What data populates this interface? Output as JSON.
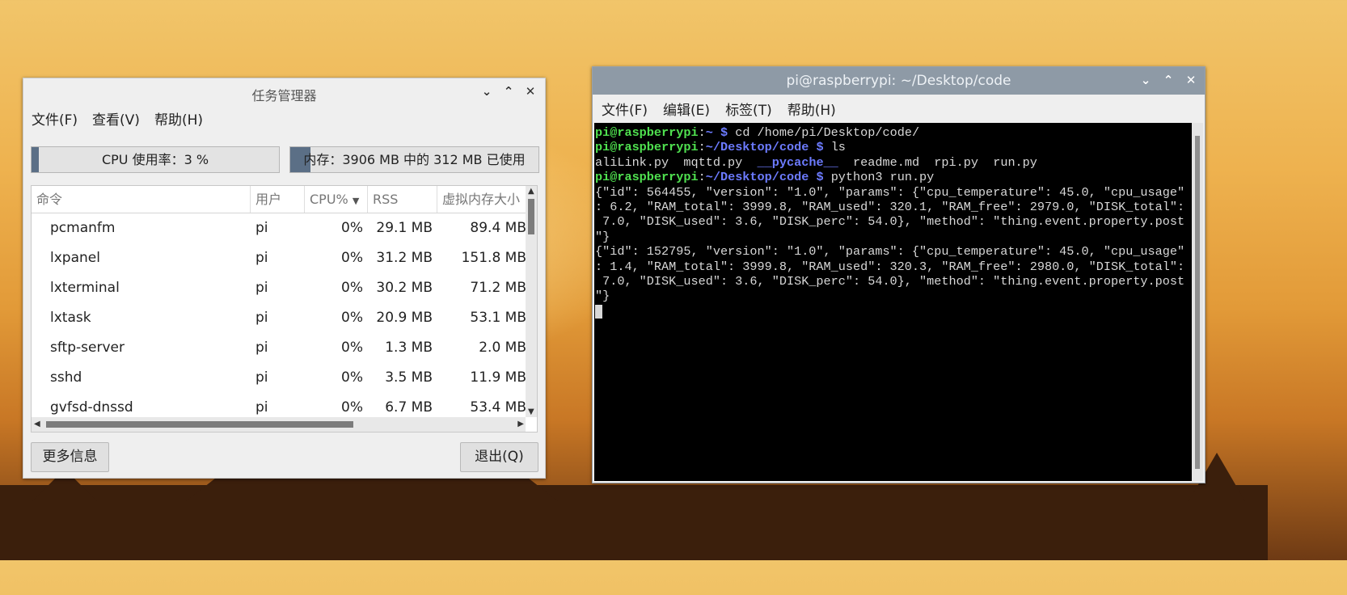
{
  "task_manager": {
    "title": "任务管理器",
    "menu": [
      "文件(F)",
      "查看(V)",
      "帮助(H)"
    ],
    "cpu_meter": {
      "label": "CPU 使用率：3 %",
      "fraction": 0.03
    },
    "mem_meter": {
      "label": "内存：3906 MB 中的 312 MB 已使用",
      "fraction": 0.08
    },
    "columns": [
      "命令",
      "用户",
      "CPU%",
      "RSS",
      "虚拟内存大小"
    ],
    "sort_column": "CPU%",
    "rows": [
      {
        "cmd": "pcmanfm",
        "user": "pi",
        "cpu": "0%",
        "rss": "29.1 MB",
        "vsz": "89.4 MB"
      },
      {
        "cmd": "lxpanel",
        "user": "pi",
        "cpu": "0%",
        "rss": "31.2 MB",
        "vsz": "151.8 MB"
      },
      {
        "cmd": "lxterminal",
        "user": "pi",
        "cpu": "0%",
        "rss": "30.2 MB",
        "vsz": "71.2 MB"
      },
      {
        "cmd": "lxtask",
        "user": "pi",
        "cpu": "0%",
        "rss": "20.9 MB",
        "vsz": "53.1 MB"
      },
      {
        "cmd": "sftp-server",
        "user": "pi",
        "cpu": "0%",
        "rss": "1.3 MB",
        "vsz": "2.0 MB"
      },
      {
        "cmd": "sshd",
        "user": "pi",
        "cpu": "0%",
        "rss": "3.5 MB",
        "vsz": "11.9 MB"
      },
      {
        "cmd": "gvfsd-dnssd",
        "user": "pi",
        "cpu": "0%",
        "rss": "6.7 MB",
        "vsz": "53.4 MB"
      }
    ],
    "more_info_button": "更多信息",
    "quit_button": "退出(Q)"
  },
  "terminal": {
    "title": "pi@raspberrypi: ~/Desktop/code",
    "menu": [
      "文件(F)",
      "编辑(E)",
      "标签(T)",
      "帮助(H)"
    ],
    "prompt_user": "pi@raspberrypi",
    "lines": [
      {
        "type": "prompt",
        "path": "~",
        "cmd": "cd /home/pi/Desktop/code/"
      },
      {
        "type": "prompt",
        "path": "~/Desktop/code",
        "cmd": "ls"
      },
      {
        "type": "ls",
        "files": [
          "aliLink.py",
          "mqttd.py",
          "__pycache__",
          "readme.md",
          "rpi.py",
          "run.py"
        ],
        "dirs": [
          "__pycache__"
        ]
      },
      {
        "type": "prompt",
        "path": "~/Desktop/code",
        "cmd": "python3 run.py"
      },
      {
        "type": "out",
        "text": "{\"id\": 564455, \"version\": \"1.0\", \"params\": {\"cpu_temperature\": 45.0, \"cpu_usage\""
      },
      {
        "type": "out",
        "text": ": 6.2, \"RAM_total\": 3999.8, \"RAM_used\": 320.1, \"RAM_free\": 2979.0, \"DISK_total\":"
      },
      {
        "type": "out",
        "text": " 7.0, \"DISK_used\": 3.6, \"DISK_perc\": 54.0}, \"method\": \"thing.event.property.post"
      },
      {
        "type": "out",
        "text": "\"}"
      },
      {
        "type": "out",
        "text": "{\"id\": 152795, \"version\": \"1.0\", \"params\": {\"cpu_temperature\": 45.0, \"cpu_usage\""
      },
      {
        "type": "out",
        "text": ": 1.4, \"RAM_total\": 3999.8, \"RAM_used\": 320.3, \"RAM_free\": 2980.0, \"DISK_total\":"
      },
      {
        "type": "out",
        "text": " 7.0, \"DISK_used\": 3.6, \"DISK_perc\": 54.0}, \"method\": \"thing.event.property.post"
      },
      {
        "type": "out",
        "text": "\"}"
      }
    ]
  },
  "colors": {
    "prompt_green": "#4fe04f",
    "path_blue": "#6c7bff",
    "terminal_bg": "#000000",
    "titlebar_active": "#8e9aa6",
    "meter_fill": "#5b6f86"
  }
}
